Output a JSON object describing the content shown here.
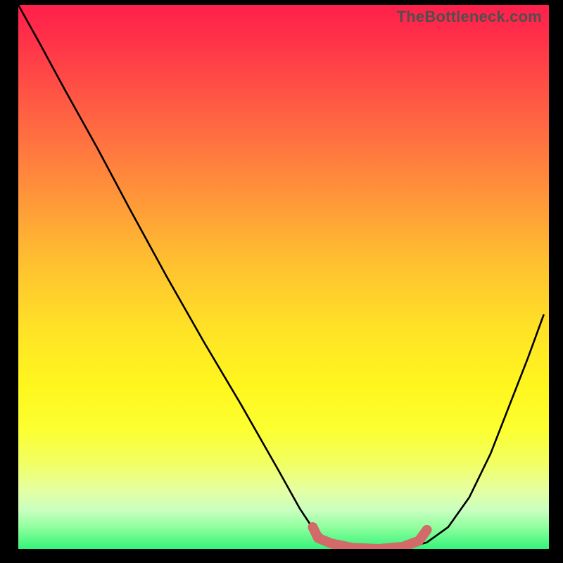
{
  "watermark": "TheBottleneck.com",
  "colors": {
    "curve": "#000000",
    "marker": "#d26a6a",
    "background_black": "#000000"
  },
  "chart_data": {
    "type": "line",
    "title": "",
    "xlabel": "",
    "ylabel": "",
    "xlim": [
      0,
      1
    ],
    "ylim": [
      0,
      1
    ],
    "series": [
      {
        "name": "bottleneck-curve",
        "x": [
          0.0,
          0.04,
          0.09,
          0.15,
          0.21,
          0.28,
          0.35,
          0.42,
          0.49,
          0.53,
          0.555,
          0.59,
          0.63,
          0.68,
          0.73,
          0.77,
          0.81,
          0.85,
          0.89,
          0.92,
          0.96,
          0.99
        ],
        "y": [
          1.0,
          0.93,
          0.84,
          0.735,
          0.625,
          0.5,
          0.38,
          0.265,
          0.145,
          0.075,
          0.038,
          0.012,
          0.002,
          0.0,
          0.002,
          0.012,
          0.04,
          0.095,
          0.175,
          0.25,
          0.35,
          0.43
        ]
      },
      {
        "name": "marker-band",
        "x": [
          0.555,
          0.565,
          0.59,
          0.63,
          0.68,
          0.725,
          0.755,
          0.77
        ],
        "y": [
          0.04,
          0.02,
          0.01,
          0.002,
          0.0,
          0.004,
          0.015,
          0.035
        ]
      }
    ]
  }
}
